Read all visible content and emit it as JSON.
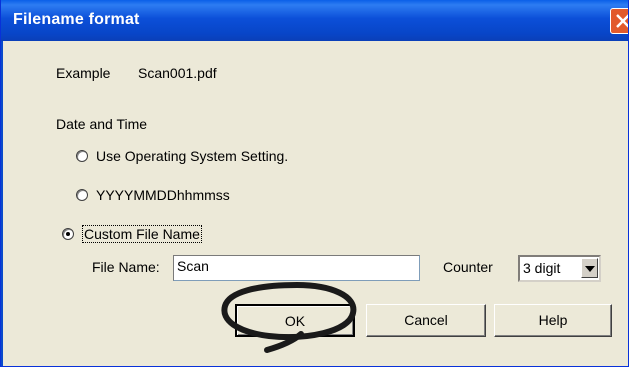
{
  "window": {
    "title": "Filename format"
  },
  "example": {
    "label": "Example",
    "value": "Scan001.pdf"
  },
  "date_time": {
    "group_label": "Date and Time",
    "options": [
      {
        "label": "Use Operating System Setting.",
        "selected": false
      },
      {
        "label": "YYYYMMDDhhmmss",
        "selected": false
      },
      {
        "label": "Custom File Name",
        "selected": true
      }
    ]
  },
  "file_name": {
    "label": "File Name:",
    "value": "Scan"
  },
  "counter": {
    "label": "Counter",
    "selected": "3 digit"
  },
  "buttons": {
    "ok": "OK",
    "cancel": "Cancel",
    "help": "Help"
  },
  "colors": {
    "title_bar": "#0846c9",
    "close": "#e25a2c",
    "dialog_bg": "#ece9d8"
  }
}
